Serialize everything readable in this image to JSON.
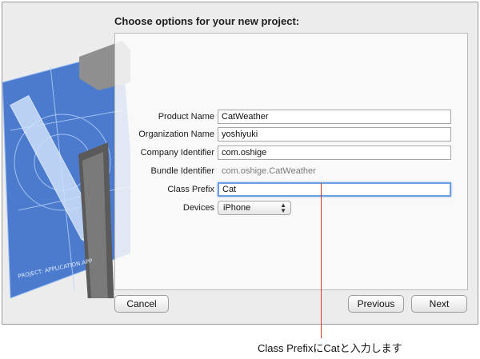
{
  "header": {
    "title": "Choose options for your new project:"
  },
  "form": {
    "product_name": {
      "label": "Product Name",
      "value": "CatWeather"
    },
    "organization_name": {
      "label": "Organization Name",
      "value": "yoshiyuki"
    },
    "company_identifier": {
      "label": "Company Identifier",
      "value": "com.oshige"
    },
    "bundle_identifier": {
      "label": "Bundle Identifier",
      "value": "com.oshige.CatWeather"
    },
    "class_prefix": {
      "label": "Class Prefix",
      "value": "Cat"
    },
    "devices": {
      "label": "Devices",
      "value": "iPhone"
    }
  },
  "buttons": {
    "cancel": "Cancel",
    "previous": "Previous",
    "next": "Next"
  },
  "annotation": {
    "text": "Class PrefixにCatと入力します"
  },
  "colors": {
    "annotation_line": "#d23a2f",
    "focus_ring": "#6d9ee0",
    "blueprint": "#3b6fcb"
  },
  "icons": [
    "hammer-icon",
    "blueprint-icon",
    "popup-arrows-icon"
  ]
}
